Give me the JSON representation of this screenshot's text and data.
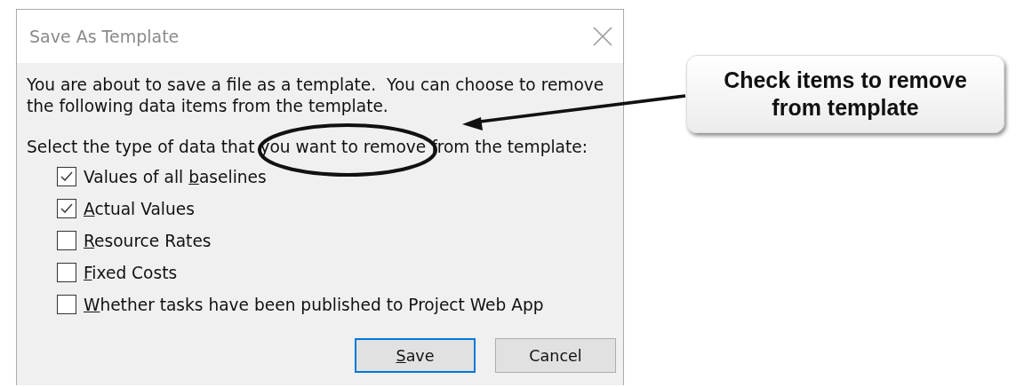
{
  "dialog": {
    "title": "Save As Template",
    "intro": "You are about to save a file as a template.  You can choose to remove the following data items from the template.",
    "prompt": "Select the type of data that you want to remove from the template:",
    "options": [
      {
        "label": {
          "before": "Values of all ",
          "key": "b",
          "after": "aselines"
        },
        "checked": true
      },
      {
        "label": {
          "key": "A",
          "after": "ctual Values"
        },
        "checked": true
      },
      {
        "label": {
          "key": "R",
          "after": "esource Rates"
        },
        "checked": false
      },
      {
        "label": {
          "key": "F",
          "after": "ixed Costs"
        },
        "checked": false
      },
      {
        "label": {
          "key": "W",
          "after": "hether tasks have been published to Project Web App"
        },
        "checked": false
      }
    ],
    "buttons": [
      {
        "label": {
          "key": "S",
          "after": "ave"
        },
        "default": true
      },
      {
        "label": {
          "before": "Cancel"
        },
        "default": false
      }
    ]
  },
  "callout": {
    "text": "Check items to remove from template"
  }
}
